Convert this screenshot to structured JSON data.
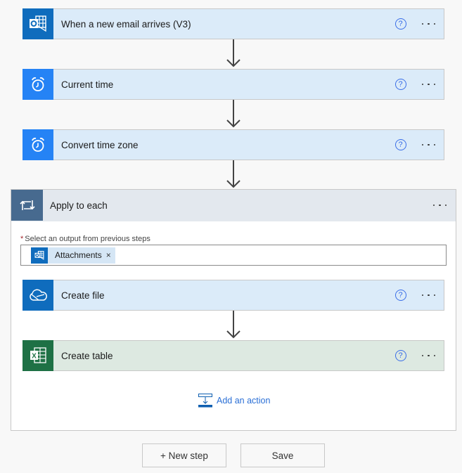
{
  "flow": {
    "steps": [
      {
        "title": "When a new email arrives (V3)",
        "icon": "outlook-icon",
        "color": "#0f6cbd",
        "theme": "blue"
      },
      {
        "title": "Current time",
        "icon": "alarm-clock-icon",
        "color": "#2583f5",
        "theme": "blue"
      },
      {
        "title": "Convert time zone",
        "icon": "alarm-clock-icon",
        "color": "#2583f5",
        "theme": "blue"
      }
    ],
    "apply_to_each": {
      "title": "Apply to each",
      "icon": "loop-icon",
      "color": "#476a8f",
      "field_label": "Select an output from previous steps",
      "required_marker": "*",
      "token": {
        "label": "Attachments",
        "close": "×",
        "icon": "outlook-icon"
      },
      "inner_steps": [
        {
          "title": "Create file",
          "icon": "onedrive-icon",
          "color": "#0f6cbd",
          "theme": "blue"
        },
        {
          "title": "Create table",
          "icon": "excel-icon",
          "color": "#1e7145",
          "theme": "green"
        }
      ],
      "add_action_label": "Add an action"
    },
    "help_glyph": "?"
  },
  "footer": {
    "new_step_label": "+ New step",
    "save_label": "Save"
  }
}
